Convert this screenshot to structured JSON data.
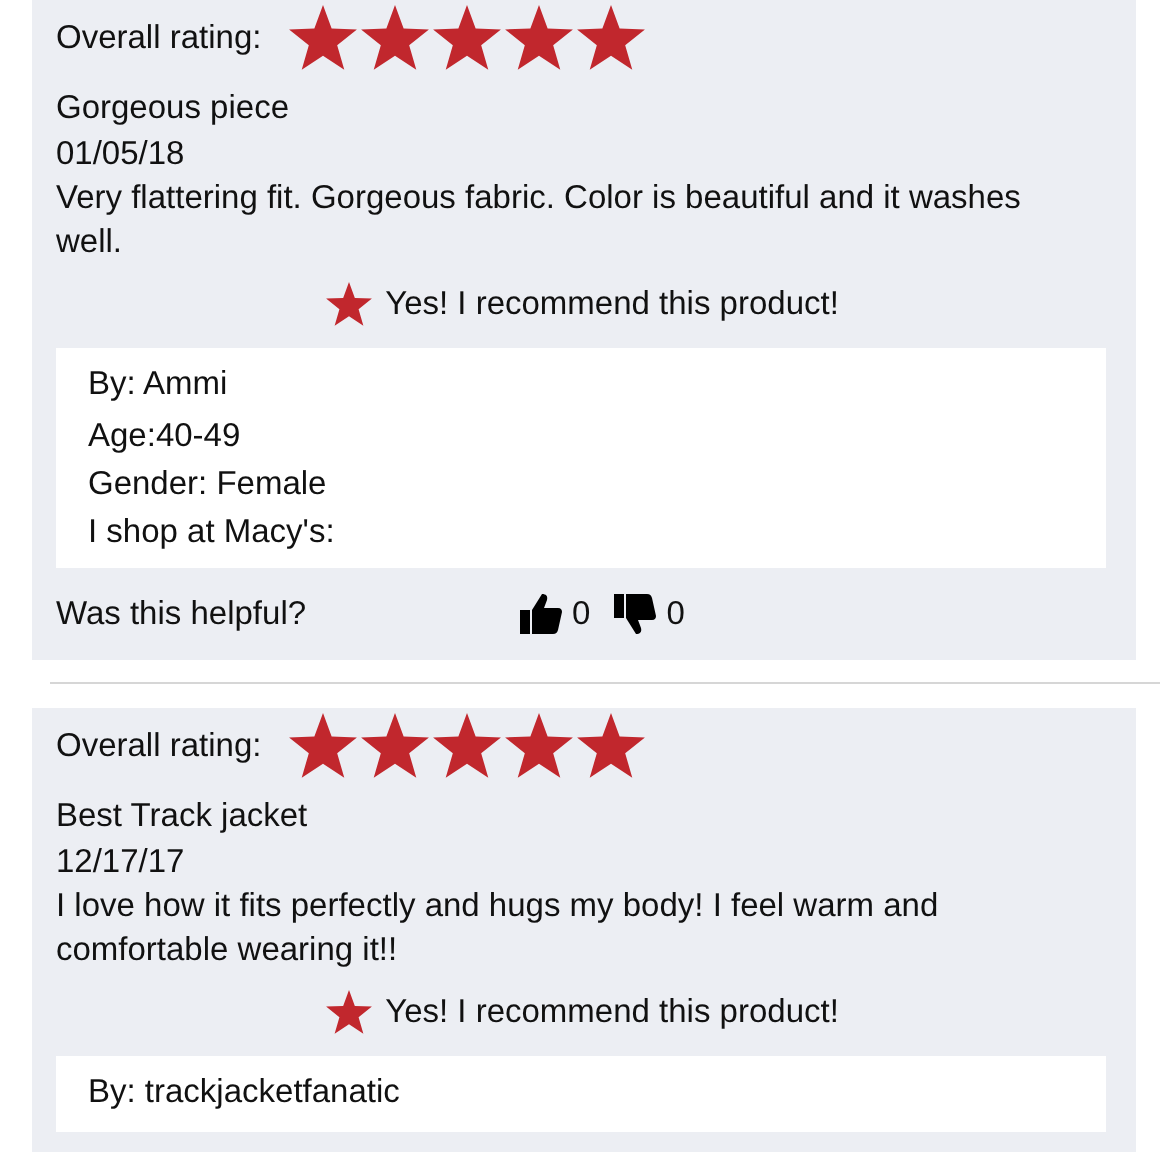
{
  "reviews": [
    {
      "rating_label": "Overall rating:",
      "stars": 5,
      "title": "Gorgeous piece",
      "date": "01/05/18",
      "text": "Very flattering fit. Gorgeous fabric. Color is beautiful and it washes well.",
      "recommended": true,
      "recommend_text": "Yes! I recommend this product!",
      "reviewer": [
        "By: Ammi",
        "Age:40-49",
        "Gender: Female",
        "I shop at Macy's:"
      ],
      "helpful": {
        "label": "Was this helpful?",
        "up": "0",
        "down": "0"
      }
    },
    {
      "rating_label": "Overall rating:",
      "stars": 5,
      "title": "Best Track jacket",
      "date": "12/17/17",
      "text": "I love how it fits perfectly and hugs my body! I feel warm and comfortable wearing it!!",
      "recommended": true,
      "recommend_text": "Yes! I recommend this product!",
      "reviewer": [
        "By: trackjacketfanatic"
      ]
    }
  ]
}
